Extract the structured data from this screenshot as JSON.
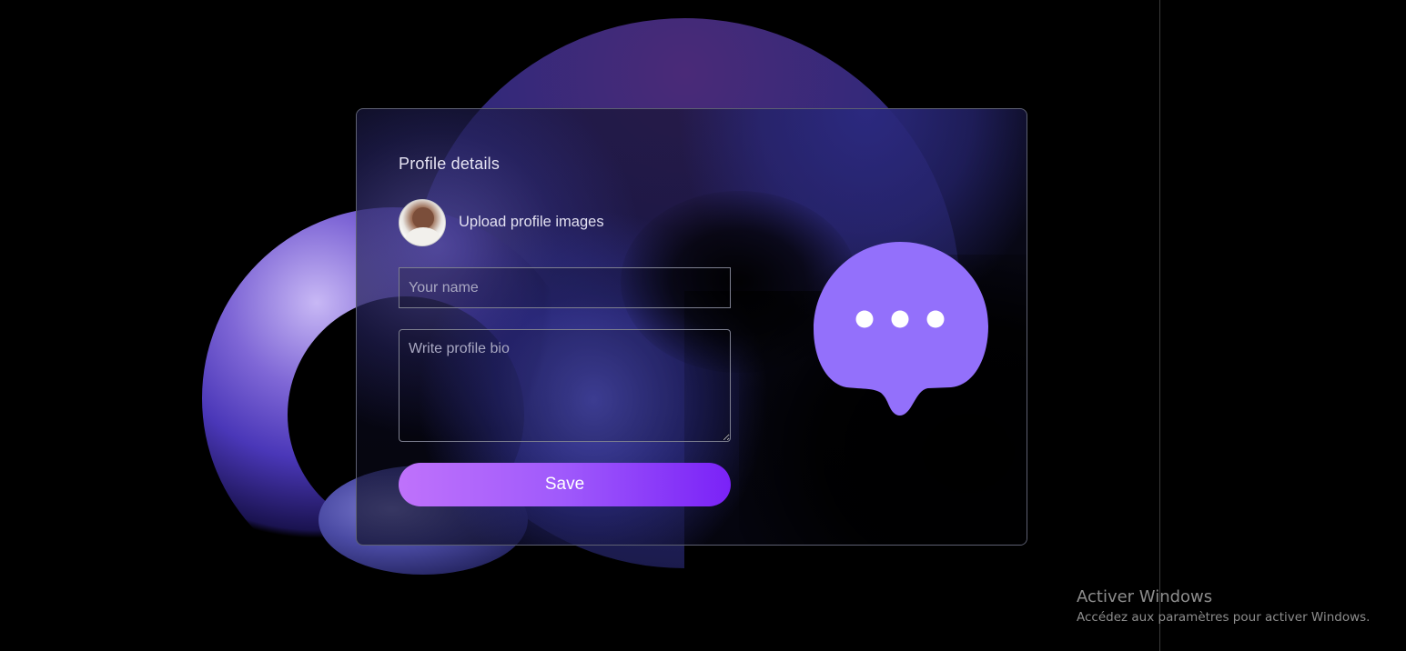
{
  "profile_card": {
    "title": "Profile details",
    "upload_label": "Upload profile images",
    "name_field": {
      "placeholder": "Your name",
      "value": ""
    },
    "bio_field": {
      "placeholder": "Write profile bio",
      "value": ""
    },
    "save_label": "Save",
    "chat_icon": "chat-bubble-dots-icon",
    "accent_colors": {
      "button_gradient_start": "#bf72fb",
      "button_gradient_end": "#7a22f7",
      "chat_bubble": "#9370fb"
    }
  },
  "watermark": {
    "title": "Activer Windows",
    "subtitle": "Accédez aux paramètres pour activer Windows."
  }
}
